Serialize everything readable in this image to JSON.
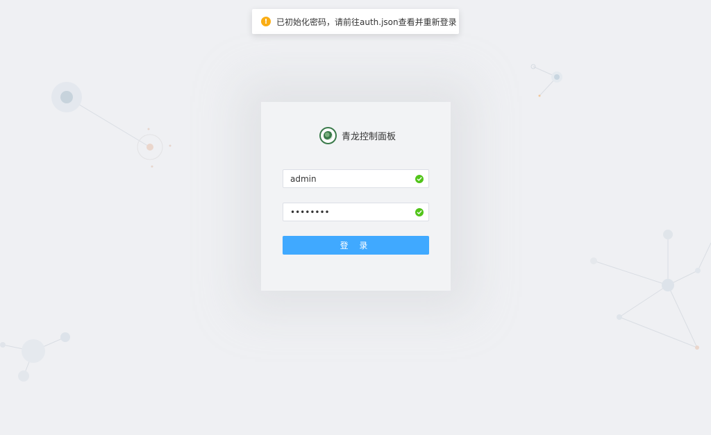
{
  "toast": {
    "icon": "warning-icon",
    "icon_glyph": "!",
    "message": "已初始化密码，请前往auth.json查看并重新登录",
    "color": "#faad14"
  },
  "login": {
    "app_title": "青龙控制面板",
    "username_value": "admin",
    "password_value": "••••••••",
    "submit_label": "登 录",
    "accent": "#40a9ff",
    "valid_color": "#52c41a"
  }
}
